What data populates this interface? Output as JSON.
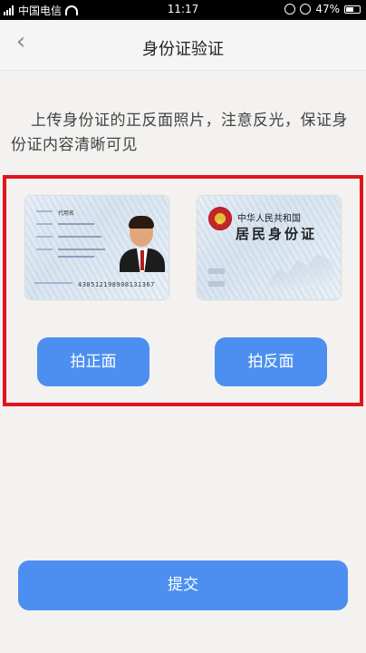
{
  "status_bar": {
    "carrier": "中国电信",
    "time": "11:17",
    "battery": "47%",
    "battery_level": 0.47
  },
  "header": {
    "title": "身份证验证",
    "back_icon": "chevron-left-icon"
  },
  "instructions": "上传身份证的正反面照片，注意反光，保证身份证内容清晰可见",
  "front_card": {
    "name_label": "代用名",
    "id_number": "430512198908131367"
  },
  "back_card": {
    "country": "中华人民共和国",
    "card_title": "居民身份证"
  },
  "buttons": {
    "front": "拍正面",
    "back": "拍反面",
    "submit": "提交"
  },
  "colors": {
    "accent": "#4c8ff0",
    "highlight_border": "#e3141a"
  }
}
